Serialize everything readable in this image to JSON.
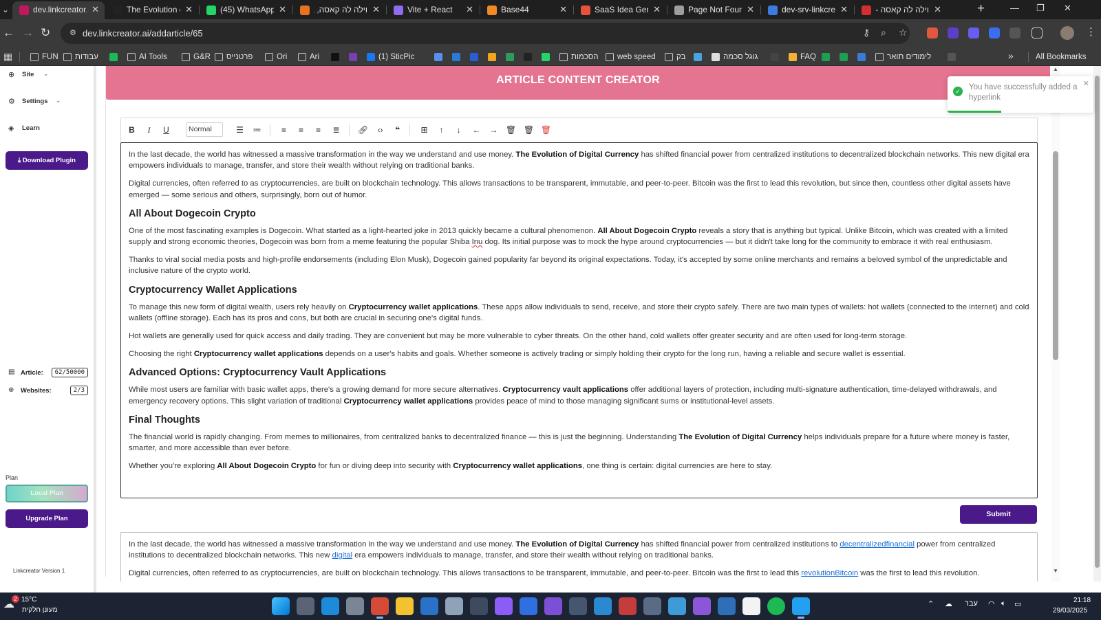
{
  "browser": {
    "tabs": [
      {
        "title": "dev.linkcreator.ai/",
        "favicon_color": "#c2185b",
        "active": true
      },
      {
        "title": "The Evolution of D",
        "favicon_color": "#222222",
        "active": false
      },
      {
        "title": "(45) WhatsApp",
        "favicon_color": "#25d366",
        "active": false
      },
      {
        "title": "וילה לה קאסה, בט",
        "favicon_color": "#e7731f",
        "active": false
      },
      {
        "title": "Vite + React",
        "favicon_color": "#8f6bf0",
        "active": false
      },
      {
        "title": "Base44",
        "favicon_color": "#f08a24",
        "active": false
      },
      {
        "title": "SaaS Idea Genera",
        "favicon_color": "#e5533d",
        "active": false
      },
      {
        "title": "Page Not Found",
        "favicon_color": "#9e9e9e",
        "active": false
      },
      {
        "title": "dev-srv-linkcreato",
        "favicon_color": "#3c7be0",
        "active": false
      },
      {
        "title": "וילה לה קאסה - ויי",
        "favicon_color": "#d32f2f",
        "active": false
      }
    ],
    "url": "dev.linkcreator.ai/addarticle/65",
    "bookmarks": [
      {
        "label": "FUN",
        "type": "folder"
      },
      {
        "label": "עבודות",
        "type": "folder"
      },
      {
        "label": "",
        "type": "site",
        "color": "#1db954"
      },
      {
        "label": "AI Tools",
        "type": "folder"
      },
      {
        "label": "G&R",
        "type": "folder"
      },
      {
        "label": "פרטנייס",
        "type": "folder"
      },
      {
        "label": "Ori",
        "type": "folder"
      },
      {
        "label": "Ari",
        "type": "folder"
      },
      {
        "label": "",
        "type": "site",
        "color": "#111111"
      },
      {
        "label": "",
        "type": "site",
        "color": "#7b3fb5"
      },
      {
        "label": "(1) SticPic",
        "type": "site",
        "color": "#1877f2"
      },
      {
        "label": "",
        "type": "site",
        "color": "#5a8dee"
      },
      {
        "label": "",
        "type": "site",
        "color": "#2a7ad9"
      },
      {
        "label": "",
        "type": "site",
        "color": "#2c5bd7"
      },
      {
        "label": "",
        "type": "site",
        "color": "#f2a51d"
      },
      {
        "label": "",
        "type": "site",
        "color": "#2e9b5b"
      },
      {
        "label": "",
        "type": "site",
        "color": "#222222"
      },
      {
        "label": "",
        "type": "site",
        "color": "#25d366"
      },
      {
        "label": "הסכמות",
        "type": "folder"
      },
      {
        "label": "web speed",
        "type": "folder"
      },
      {
        "label": "בק",
        "type": "folder"
      },
      {
        "label": "",
        "type": "site",
        "color": "#4aa3df"
      },
      {
        "label": "גוגל סכמה",
        "type": "site",
        "color": "#dddddd"
      },
      {
        "label": "",
        "type": "site",
        "color": "#444444"
      },
      {
        "label": "FAQ",
        "type": "site",
        "color": "#f2b233"
      },
      {
        "label": "",
        "type": "site",
        "color": "#1e9e50"
      },
      {
        "label": "",
        "type": "site",
        "color": "#1e9e50"
      },
      {
        "label": "",
        "type": "site",
        "color": "#3a7bd5"
      },
      {
        "label": "לימודים תואר",
        "type": "folder"
      },
      {
        "label": "",
        "type": "site",
        "color": "#555555"
      }
    ],
    "all_bookmarks": "All Bookmarks"
  },
  "sidebar": {
    "items": [
      {
        "label": "Site",
        "icon": "globe-icon",
        "chevron": true
      },
      {
        "label": "Settings",
        "icon": "gear-icon",
        "chevron": true
      },
      {
        "label": "Learn",
        "icon": "learn-icon",
        "chevron": false
      }
    ],
    "download_label": "Download Plugin",
    "article_label": "Article:",
    "article_value": "62/50000",
    "websites_label": "Websites:",
    "websites_value": "2/3",
    "plan_label": "Plan",
    "plan_badge": "Local Plan",
    "upgrade_label": "Upgrade Plan",
    "version": "Linkcreator Version 1"
  },
  "page": {
    "title": "ARTICLE CONTENT CREATOR",
    "submit_label": "Submit"
  },
  "editor_toolbar": {
    "format_value": "Normal"
  },
  "toast": {
    "message": "You have successfully added a hyperlink",
    "progress": 0.37
  },
  "article": [
    {
      "type": "p",
      "runs": [
        {
          "t": "In the last decade, the world has witnessed a massive transformation in the way we understand and use money. "
        },
        {
          "t": "The Evolution of Digital Currency",
          "b": true
        },
        {
          "t": " has shifted financial power from centralized institutions to decentralized blockchain networks. This new digital era empowers individuals to manage, transfer, and store their wealth without relying on traditional banks."
        }
      ]
    },
    {
      "type": "p",
      "runs": [
        {
          "t": "Digital currencies, often referred to as cryptocurrencies, are built on blockchain technology. This allows transactions to be transparent, immutable, and peer-to-peer. Bitcoin was the first to lead this revolution, but since then, countless other digital assets have emerged — some serious and others, surprisingly, born out of humor."
        }
      ]
    },
    {
      "type": "h",
      "text": "All About Dogecoin Crypto"
    },
    {
      "type": "p",
      "runs": [
        {
          "t": "One of the most fascinating examples is Dogecoin. What started as a light-hearted joke in 2013 quickly became a cultural phenomenon. "
        },
        {
          "t": "All About Dogecoin Crypto",
          "b": true
        },
        {
          "t": " reveals a story that is anything but typical. Unlike Bitcoin, which was created with a limited supply and strong economic theories, Dogecoin was born from a meme featuring the popular Shiba "
        },
        {
          "t": "Inu",
          "sq": true
        },
        {
          "t": " dog. Its initial purpose was to mock the hype around cryptocurrencies — but it didn't take long for the community to embrace it with real enthusiasm."
        }
      ]
    },
    {
      "type": "p",
      "runs": [
        {
          "t": "Thanks to viral social media posts and high-profile endorsements (including Elon Musk), Dogecoin gained popularity far beyond its original expectations. Today, it's accepted by some online merchants and remains a beloved symbol of the unpredictable and inclusive nature of the crypto world."
        }
      ]
    },
    {
      "type": "h",
      "text": "Cryptocurrency Wallet Applications"
    },
    {
      "type": "p",
      "runs": [
        {
          "t": "To manage this new form of digital wealth, users rely heavily on "
        },
        {
          "t": "Cryptocurrency wallet applications",
          "b": true
        },
        {
          "t": ". These apps allow individuals to send, receive, and store their crypto safely. There are two main types of wallets: hot wallets (connected to the internet) and cold wallets (offline storage). Each has its pros and cons, but both are crucial in securing one's digital funds."
        }
      ]
    },
    {
      "type": "p",
      "runs": [
        {
          "t": "Hot wallets are generally used for quick access and daily trading. They are convenient but may be more vulnerable to cyber threats. On the other hand, cold wallets offer greater security and are often used for long-term storage."
        }
      ]
    },
    {
      "type": "p",
      "runs": [
        {
          "t": "Choosing the right "
        },
        {
          "t": "Cryptocurrency wallet applications",
          "b": true
        },
        {
          "t": " depends on a user's habits and goals. Whether someone is actively trading or simply holding their crypto for the long run, having a reliable and secure wallet is essential."
        }
      ]
    },
    {
      "type": "h",
      "text": "Advanced Options: Cryptocurrency Vault Applications"
    },
    {
      "type": "p",
      "runs": [
        {
          "t": "While most users are familiar with basic wallet apps, there's a growing demand for more secure alternatives. "
        },
        {
          "t": "Cryptocurrency vault applications",
          "b": true
        },
        {
          "t": " offer additional layers of protection, including multi-signature authentication, time-delayed withdrawals, and emergency recovery options. This slight variation of traditional "
        },
        {
          "t": "Cryptocurrency wallet applications",
          "b": true
        },
        {
          "t": " provides peace of mind to those managing significant sums or institutional-level assets."
        }
      ]
    },
    {
      "type": "h",
      "text": "Final Thoughts"
    },
    {
      "type": "p",
      "runs": [
        {
          "t": "The financial world is rapidly changing. From memes to millionaires, from centralized banks to decentralized finance — this is just the beginning. Understanding "
        },
        {
          "t": "The Evolution of Digital Currency",
          "b": true
        },
        {
          "t": " helps individuals prepare for a future where money is faster, smarter, and more accessible than ever before."
        }
      ]
    },
    {
      "type": "p",
      "runs": [
        {
          "t": "Whether you're exploring "
        },
        {
          "t": "All About Dogecoin Crypto",
          "b": true
        },
        {
          "t": " for fun or diving deep into security with "
        },
        {
          "t": "Cryptocurrency wallet applications",
          "b": true
        },
        {
          "t": ", one thing is certain: digital currencies are here to stay."
        }
      ]
    }
  ],
  "preview": [
    {
      "type": "p",
      "runs": [
        {
          "t": "In the last decade, the world has witnessed a massive transformation in the way we understand and use money. "
        },
        {
          "t": "The Evolution of Digital Currency",
          "b": true
        },
        {
          "t": " has shifted financial power from centralized institutions to "
        },
        {
          "t": "decentralizedfinancial",
          "link": true
        },
        {
          "t": " power from centralized institutions to decentralized blockchain networks. This new "
        },
        {
          "t": "digital",
          "link": true
        },
        {
          "t": " era empowers individuals to manage, transfer, and store their wealth without relying on traditional banks."
        }
      ]
    },
    {
      "type": "p",
      "runs": [
        {
          "t": "Digital currencies, often referred to as cryptocurrencies, are built on blockchain technology. This allows transactions to be transparent, immutable, and peer-to-peer. Bitcoin was the first to lead this "
        },
        {
          "t": "revolutionBitcoin",
          "link": true
        },
        {
          "t": " was the first to lead this revolution."
        }
      ]
    }
  ],
  "taskbar": {
    "weather_badge": "2",
    "weather_temp": "15°C",
    "weather_desc": "מעונן חלקית",
    "language": "עבר",
    "time": "21:18",
    "date": "29/03/2025"
  }
}
